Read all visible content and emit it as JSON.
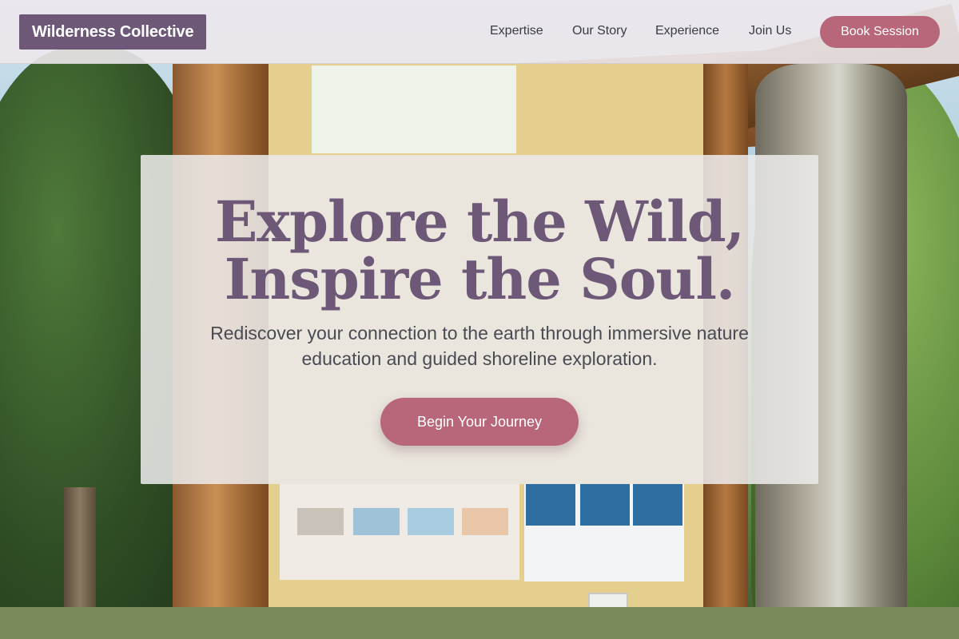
{
  "brand": {
    "name": "Wilderness Collective",
    "accent_color": "#6d5878",
    "button_color": "#b8667a"
  },
  "nav": {
    "items": [
      {
        "label": "Expertise"
      },
      {
        "label": "Our Story"
      },
      {
        "label": "Experience"
      },
      {
        "label": "Join Us"
      }
    ],
    "cta_label": "Book Session"
  },
  "hero": {
    "title_line1": "Explore the Wild,",
    "title_line2": "Inspire the Soul.",
    "subtitle_line1": "Rediscover your connection to the earth through immersive nature",
    "subtitle_line2": "education and guided shoreline exploration.",
    "cta_label": "Begin Your Journey"
  },
  "background": {
    "icon": "nature-photo-kiosk"
  }
}
